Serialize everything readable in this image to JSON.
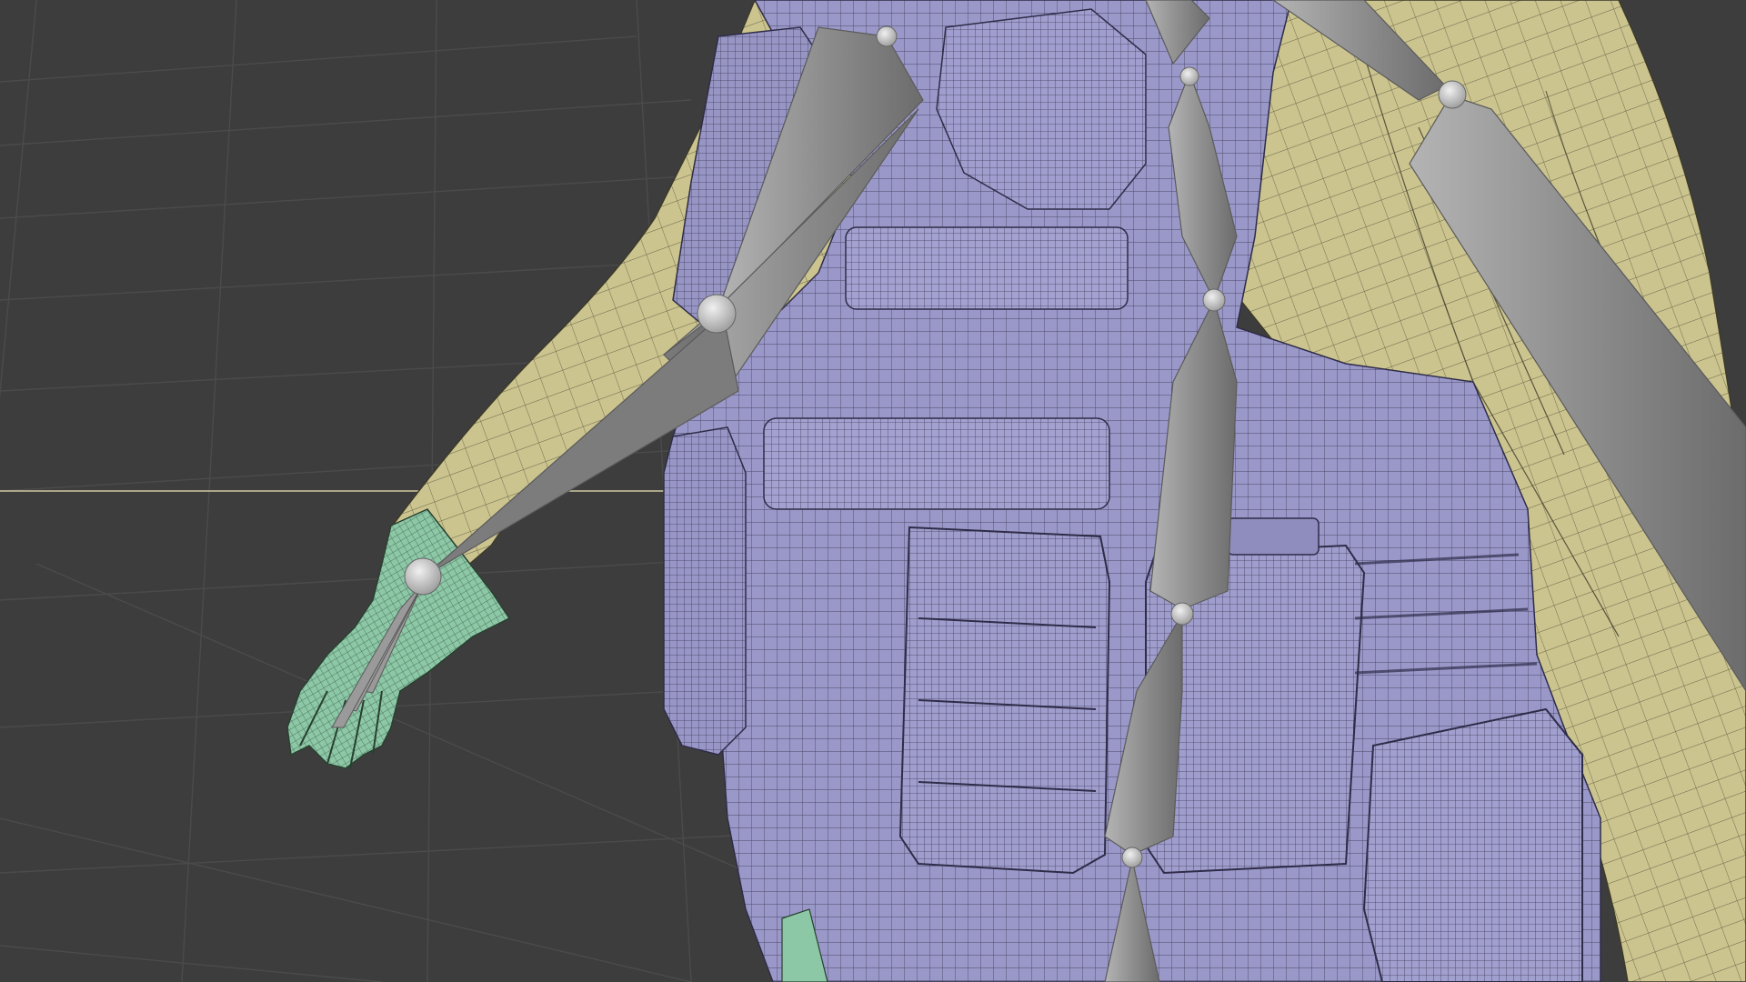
{
  "viewport": {
    "background": "#3d3d3d",
    "grid_color": "#4b4b4b",
    "x_axis_color": "#cfc9a0",
    "z_axis_color": "#9ec7a5"
  },
  "scene": {
    "objects": [
      {
        "name": "body",
        "color": "#cbc48f",
        "wire": "#3d3a28"
      },
      {
        "name": "tactical-vest",
        "color": "#9a98c8",
        "wire": "#2e2c48"
      },
      {
        "name": "glove",
        "color": "#8cc7a6",
        "wire": "#28402f"
      }
    ],
    "armature": {
      "bone_color": "#8e8e8e",
      "bone_edge": "#5a5a5a",
      "joint_color": "#cfcfcf"
    }
  }
}
